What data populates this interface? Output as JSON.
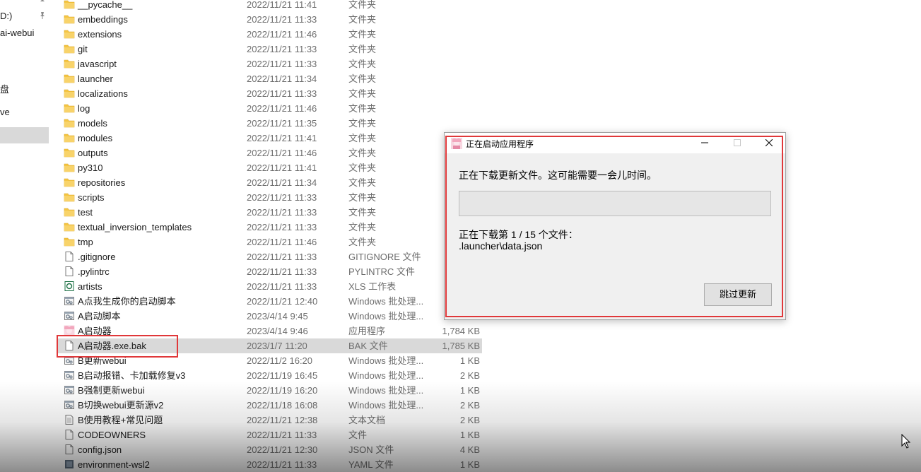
{
  "nav": {
    "items": [
      {
        "label": "D:)",
        "pinned": true
      },
      {
        "label": "ai-webui",
        "pinned": false
      },
      {
        "label": "盘",
        "pinned": false
      },
      {
        "label": "ve",
        "pinned": false
      },
      {
        "label": "",
        "pinned": false,
        "selected": true
      }
    ]
  },
  "files": [
    {
      "name": "__pycache__",
      "date": "2022/11/21 11:41",
      "type": "文件夹",
      "size": "",
      "icon": "folder-icon"
    },
    {
      "name": "embeddings",
      "date": "2022/11/21 11:33",
      "type": "文件夹",
      "size": "",
      "icon": "folder-icon"
    },
    {
      "name": "extensions",
      "date": "2022/11/21 11:46",
      "type": "文件夹",
      "size": "",
      "icon": "folder-icon"
    },
    {
      "name": "git",
      "date": "2022/11/21 11:33",
      "type": "文件夹",
      "size": "",
      "icon": "folder-icon"
    },
    {
      "name": "javascript",
      "date": "2022/11/21 11:33",
      "type": "文件夹",
      "size": "",
      "icon": "folder-icon"
    },
    {
      "name": "launcher",
      "date": "2022/11/21 11:34",
      "type": "文件夹",
      "size": "",
      "icon": "folder-icon"
    },
    {
      "name": "localizations",
      "date": "2022/11/21 11:33",
      "type": "文件夹",
      "size": "",
      "icon": "folder-icon"
    },
    {
      "name": "log",
      "date": "2022/11/21 11:46",
      "type": "文件夹",
      "size": "",
      "icon": "folder-icon"
    },
    {
      "name": "models",
      "date": "2022/11/21 11:35",
      "type": "文件夹",
      "size": "",
      "icon": "folder-icon"
    },
    {
      "name": "modules",
      "date": "2022/11/21 11:41",
      "type": "文件夹",
      "size": "",
      "icon": "folder-icon"
    },
    {
      "name": "outputs",
      "date": "2022/11/21 11:46",
      "type": "文件夹",
      "size": "",
      "icon": "folder-icon"
    },
    {
      "name": "py310",
      "date": "2022/11/21 11:41",
      "type": "文件夹",
      "size": "",
      "icon": "folder-icon"
    },
    {
      "name": "repositories",
      "date": "2022/11/21 11:34",
      "type": "文件夹",
      "size": "",
      "icon": "folder-icon"
    },
    {
      "name": "scripts",
      "date": "2022/11/21 11:33",
      "type": "文件夹",
      "size": "",
      "icon": "folder-icon"
    },
    {
      "name": "test",
      "date": "2022/11/21 11:33",
      "type": "文件夹",
      "size": "",
      "icon": "folder-icon"
    },
    {
      "name": "textual_inversion_templates",
      "date": "2022/11/21 11:33",
      "type": "文件夹",
      "size": "",
      "icon": "folder-icon"
    },
    {
      "name": "tmp",
      "date": "2022/11/21 11:46",
      "type": "文件夹",
      "size": "",
      "icon": "folder-icon"
    },
    {
      "name": ".gitignore",
      "date": "2022/11/21 11:33",
      "type": "GITIGNORE 文件",
      "size": "",
      "icon": "file-icon"
    },
    {
      "name": ".pylintrc",
      "date": "2022/11/21 11:33",
      "type": "PYLINTRC 文件",
      "size": "",
      "icon": "file-icon"
    },
    {
      "name": "artists",
      "date": "2022/11/21 11:33",
      "type": "XLS 工作表",
      "size": "",
      "icon": "spreadsheet-icon"
    },
    {
      "name": "A点我生成你的启动脚本",
      "date": "2022/11/21 12:40",
      "type": "Windows 批处理...",
      "size": "",
      "icon": "batch-file-icon"
    },
    {
      "name": "A启动脚本",
      "date": "2023/4/14 9:45",
      "type": "Windows 批处理...",
      "size": "",
      "icon": "batch-file-icon"
    },
    {
      "name": "A启动器",
      "date": "2023/4/14 9:46",
      "type": "应用程序",
      "size": "1,784 KB",
      "icon": "app-icon"
    },
    {
      "name": "A启动器.exe.bak",
      "date": "2023/1/7 11:20",
      "type": "BAK 文件",
      "size": "1,785 KB",
      "icon": "file-icon",
      "selected": true
    },
    {
      "name": "B更新webui",
      "date": "2022/11/2 16:20",
      "type": "Windows 批处理...",
      "size": "1 KB",
      "icon": "batch-file-icon"
    },
    {
      "name": "B启动报错、卡加载修复v3",
      "date": "2022/11/19 16:45",
      "type": "Windows 批处理...",
      "size": "2 KB",
      "icon": "batch-file-icon"
    },
    {
      "name": "B强制更新webui",
      "date": "2022/11/19 16:20",
      "type": "Windows 批处理...",
      "size": "1 KB",
      "icon": "batch-file-icon"
    },
    {
      "name": "B切换webui更新源v2",
      "date": "2022/11/18 16:08",
      "type": "Windows 批处理...",
      "size": "2 KB",
      "icon": "batch-file-icon"
    },
    {
      "name": "B使用教程+常见问题",
      "date": "2022/11/21 12:38",
      "type": "文本文档",
      "size": "2 KB",
      "icon": "text-file-icon"
    },
    {
      "name": "CODEOWNERS",
      "date": "2022/11/21 11:33",
      "type": "文件",
      "size": "1 KB",
      "icon": "file-icon"
    },
    {
      "name": "config.json",
      "date": "2022/11/21 12:30",
      "type": "JSON 文件",
      "size": "4 KB",
      "icon": "file-icon"
    },
    {
      "name": "environment-wsl2",
      "date": "2022/11/21 11:33",
      "type": "YAML 文件",
      "size": "1 KB",
      "icon": "yaml-file-icon"
    }
  ],
  "dialog": {
    "title": "正在启动应用程序",
    "message": "正在下载更新文件。这可能需要一会儿时间。",
    "progress_fraction": 0,
    "status_line": "正在下载第 1 / 15 个文件：",
    "current_file": ".launcher\\data.json",
    "skip_label": "跳过更新"
  },
  "colors": {
    "highlight": "#e0383a",
    "folder": "#f5c542",
    "progress_fill": "#06b025"
  }
}
